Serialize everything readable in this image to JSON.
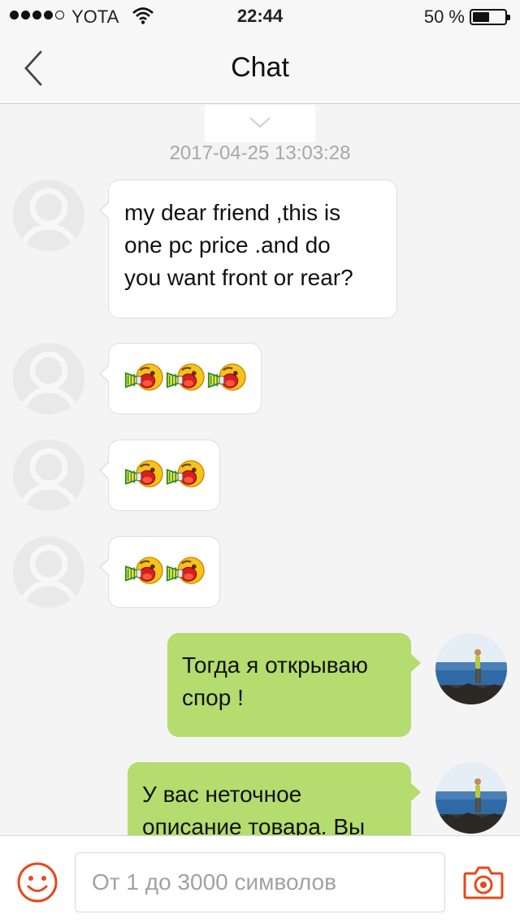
{
  "status_bar": {
    "carrier": "YOTA",
    "time": "22:44",
    "battery": "50 %",
    "battery_level": 0.5
  },
  "nav": {
    "title": "Chat",
    "back_icon": "chevron-left-icon"
  },
  "chat": {
    "load_more_icon": "chevron-down-icon",
    "timestamp": "2017-04-25 13:03:28",
    "messages": [
      {
        "side": "incoming",
        "type": "text",
        "lines": [
          "my dear friend ,this is",
          "one pc price .and do",
          "you want front or rear?"
        ]
      },
      {
        "side": "incoming",
        "type": "emoji",
        "emoji": "megaphone-emoji",
        "count": 3
      },
      {
        "side": "incoming",
        "type": "emoji",
        "emoji": "megaphone-emoji",
        "count": 2
      },
      {
        "side": "incoming",
        "type": "emoji",
        "emoji": "megaphone-emoji",
        "count": 2
      },
      {
        "side": "outgoing",
        "type": "text",
        "lines": [
          "Тогда я открываю",
          "спор !"
        ]
      },
      {
        "side": "outgoing",
        "type": "text",
        "lines": [
          "У вас неточное",
          "описание товара. Вы"
        ]
      }
    ]
  },
  "input_bar": {
    "placeholder": "От 1 до 3000 символов",
    "emoji_icon": "smiley-icon",
    "camera_icon": "camera-icon"
  },
  "colors": {
    "accent": "#e8481c",
    "outgoing_bubble": "#b4dc6e",
    "incoming_bubble": "#ffffff",
    "background": "#f4f4f4"
  }
}
